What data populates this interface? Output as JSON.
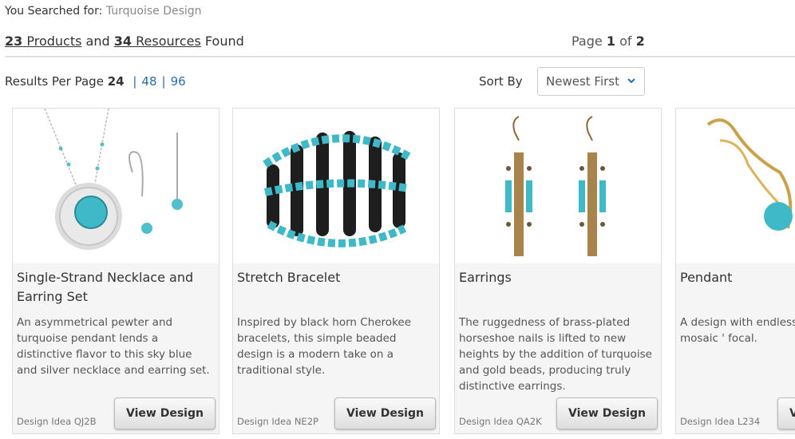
{
  "search": {
    "label": "You Searched for:",
    "term": "Turquoise Design"
  },
  "results": {
    "products_count": "23",
    "products_label": "Products",
    "and": "and",
    "resources_count": "34",
    "resources_label": "Resources",
    "found": "Found"
  },
  "pagination": {
    "page_label": "Page",
    "current": "1",
    "of": "of",
    "total": "2"
  },
  "per_page": {
    "label": "Results Per Page",
    "current": "24",
    "options": [
      "48",
      "96"
    ],
    "sep": "|"
  },
  "sort": {
    "label": "Sort By",
    "value": "Newest First"
  },
  "cards": [
    {
      "title": "Single-Strand Necklace and Earring Set",
      "description": "An asymmetrical pewter and turquoise pendant lends a distinctive flavor to this sky blue and silver necklace and earring set.",
      "code": "Design Idea QJ2B",
      "button": "View Design"
    },
    {
      "title": "Stretch Bracelet",
      "description": "Inspired by black horn Cherokee bracelets, this simple beaded design is a modern take on a traditional style.",
      "code": "Design Idea NE2P",
      "button": "View Design"
    },
    {
      "title": "Earrings",
      "description": "The ruggedness of brass-plated horseshoe nails is lifted to new heights by the addition of turquoise and gold beads, producing truly distinctive earrings.",
      "code": "Design Idea QA2K",
      "button": "View Design"
    },
    {
      "title": "Pendant",
      "description": "A design with endless weaves and a mosaic ' focal.",
      "code": "Design Idea L234",
      "button": "View Design"
    }
  ],
  "colors": {
    "link": "#2a6ca8",
    "turquoise": "#3fb8c8",
    "card_bg": "#f5f5f5"
  }
}
